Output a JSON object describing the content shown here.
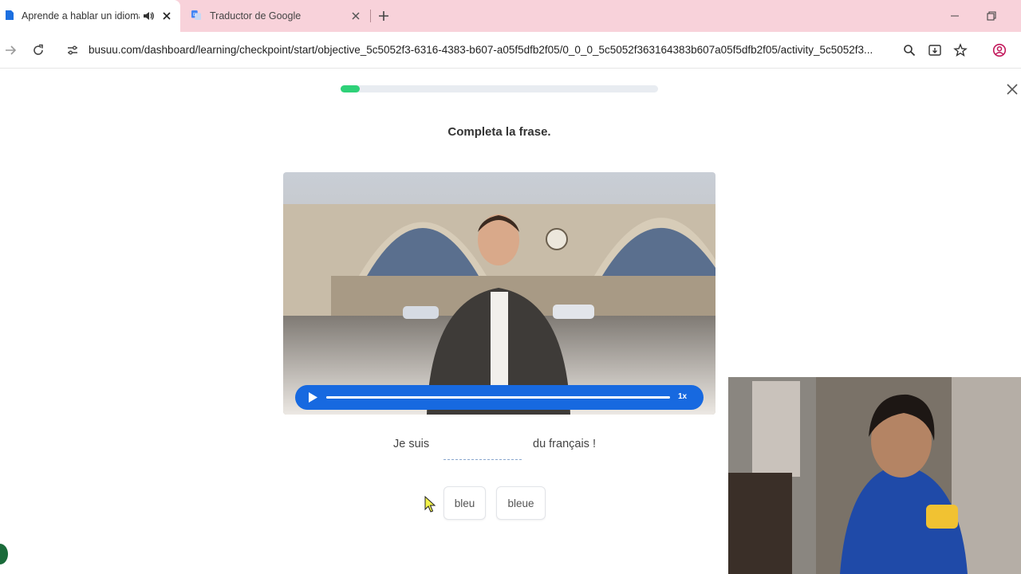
{
  "browser": {
    "tabs": [
      {
        "title": "Aprende a hablar un idioma",
        "active": true,
        "audio": true
      },
      {
        "title": "Traductor de Google",
        "active": false
      }
    ],
    "url": "busuu.com/dashboard/learning/checkpoint/start/objective_5c5052f3-6316-4383-b607-a05f5dfb2f05/0_0_0_5c5052f363164383b607a05f5dfb2f05/activity_5c5052f3..."
  },
  "lesson": {
    "progress": 0.06,
    "instruction": "Completa la frase.",
    "player": {
      "speed": "1x"
    },
    "sentence": {
      "before": "Je suis",
      "after": "du français !"
    },
    "options": [
      "bleu",
      "bleue"
    ]
  },
  "colors": {
    "tabstrip": "#f8d2da",
    "progress": "#2ed178",
    "player": "#1769e0"
  }
}
